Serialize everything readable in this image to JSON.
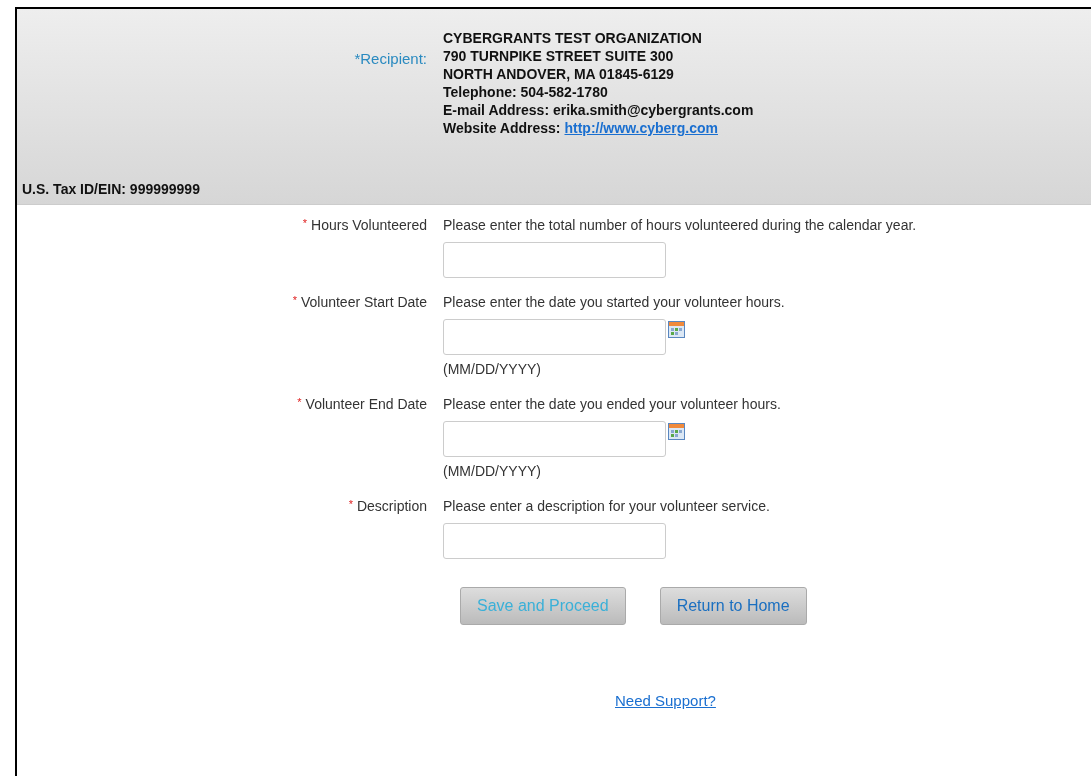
{
  "recipient": {
    "label": "*Recipient:",
    "lines": [
      "CYBERGRANTS TEST ORGANIZATION",
      "790 TURNPIKE STREET SUITE 300",
      "NORTH ANDOVER, MA 01845-6129",
      "Telephone: 504-582-1780",
      "E-mail Address: erika.smith@cybergrants.com"
    ],
    "website_label": "Website Address:",
    "website": "http://www.cyberg.com"
  },
  "tax_id": "U.S. Tax ID/EIN: 999999999",
  "fields": [
    {
      "kind": "text",
      "required": "*",
      "label": "Hours Volunteered",
      "help": "Please enter the total number of hours volunteered during the calendar year."
    },
    {
      "kind": "date",
      "required": "*",
      "label": "Volunteer Start Date",
      "help": "Please enter the date you started your volunteer hours.",
      "format": "(MM/DD/YYYY)"
    },
    {
      "kind": "date",
      "required": "*",
      "label": "Volunteer End Date",
      "help": "Please enter the date you ended your volunteer hours.",
      "format": "(MM/DD/YYYY)"
    },
    {
      "kind": "text",
      "required": "*",
      "label": "Description",
      "help": "Please enter a description for your volunteer service."
    }
  ],
  "buttons": [
    {
      "label": "Save and Proceed",
      "disabled": true
    },
    {
      "label": "Return to Home",
      "disabled": false
    }
  ],
  "support_link": "Need Support?"
}
